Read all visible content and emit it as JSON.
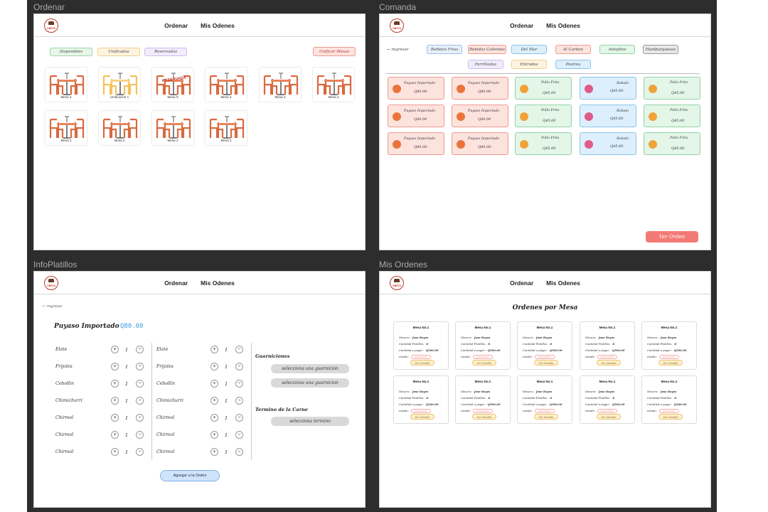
{
  "frames": {
    "ordenar": "Ordenar",
    "comanda": "Comanda",
    "infoplatillos": "InfoPlatillos",
    "misordenes": "Mis Ordenes"
  },
  "nav": {
    "ordenar": "Ordenar",
    "mis_odenes": "Mis Odenes"
  },
  "logo_text": "OBSTA",
  "ordenar": {
    "legend": {
      "disponibles": "Disponibles",
      "unificadas": "Unificadas",
      "reservadas": "Reservadas"
    },
    "unificar": "Unificar Mesas",
    "tables": [
      "Mesa 2",
      "Unificacion 1",
      "Mesa 9",
      "Mesa 2",
      "Mesa 2",
      "Mesa 2",
      "Mesa 2",
      "Mesa 2",
      "Mesa 2",
      "Mesa 2"
    ],
    "reserved_overlay": "RESERVADA"
  },
  "comanda": {
    "back": "← regresar",
    "categories": [
      "Bebidas Frias",
      "Bebidas Calientes",
      "Del Mar",
      "Al Carbon",
      "Antojitos",
      "Hamburguesas",
      "Parrilladas",
      "Entradas",
      "Postres"
    ],
    "dish_a": {
      "name": "Puyaso Importado",
      "price": "Q80.00"
    },
    "dish_b": {
      "name": "Pollo Frito",
      "price": "Q45.00"
    },
    "dish_c": {
      "name": "Robalo",
      "price": "Q45.00"
    },
    "ver_orden": "Ver Orden"
  },
  "info": {
    "back": "← regresar",
    "dish": "Puyaso Importado",
    "price": "Q80.00",
    "sides": [
      "Elote",
      "Frijoles",
      "Cebollin",
      "Chimichurri",
      "Chirmol",
      "Chirmol",
      "Chirmol"
    ],
    "qty": "1",
    "plus": "+",
    "minus": "−",
    "guarniciones_title": "Guarniciones",
    "select_guarnicion": "selecciona una guarnicion",
    "termino_title": "Termino de la Carne",
    "select_termino": "selecciona termino",
    "add_btn": "Agregar a la Orden"
  },
  "ordenes": {
    "title": "Ordenes por Mesa",
    "card": {
      "mesa": "Mesa No.1",
      "mesero_label": "Mesero:",
      "mesero": "Jose Reyes",
      "cantidad_label": "Cantidad Platillos:",
      "cantidad": "8",
      "pagar_label": "Cantidad a pagar:",
      "pagar": "Q500.00",
      "estado_label": "estado:",
      "estado": "preparando",
      "detalle": "Ver Detalle"
    }
  },
  "colors": {
    "disponible_bg": "#e7f7ea",
    "disponible_bd": "#9fd6a8",
    "unificada_bg": "#fdf3df",
    "unificada_bd": "#f0cf8f",
    "reservada_bg": "#f1ecfb",
    "reservada_bd": "#cbbcf0",
    "red_bg": "#fde3de",
    "red_bd": "#ee9a8e",
    "green_bg": "#e3f6e8",
    "green_bd": "#93d3a4",
    "blue_bg": "#ddeffc",
    "blue_bd": "#8cc4ea",
    "accent": "#f27a75"
  }
}
